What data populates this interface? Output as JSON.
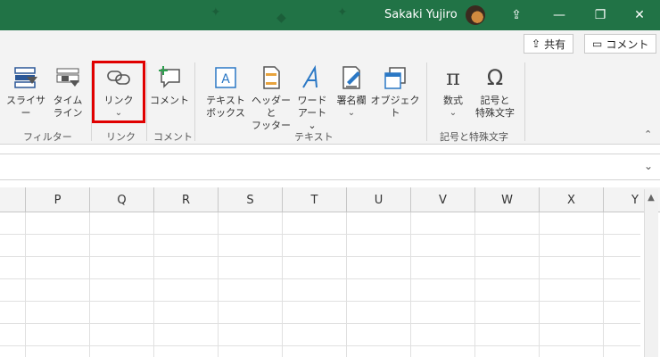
{
  "titlebar": {
    "user_name": "Sakaki Yujiro",
    "accent_color": "#217346"
  },
  "ribbon": {
    "share_label": "共有",
    "comment_label": "コメント",
    "tools": {
      "slicer": "スライサー",
      "timeline_1": "タイム",
      "timeline_2": "ライン",
      "link": "リンク",
      "comment": "コメント",
      "textbox_1": "テキスト",
      "textbox_2": "ボックス",
      "headerfooter_1": "ヘッダーと",
      "headerfooter_2": "フッター",
      "wordart_1": "ワード",
      "wordart_2": "アート",
      "signature": "署名欄",
      "object": "オブジェクト",
      "equation": "数式",
      "symbol_1": "記号と",
      "symbol_2": "特殊文字"
    },
    "groups": {
      "filter": "フィルター",
      "link": "リンク",
      "comment": "コメント",
      "text": "テキスト",
      "symbols": "記号と特殊文字"
    }
  },
  "grid": {
    "columns": [
      "P",
      "Q",
      "R",
      "S",
      "T",
      "U",
      "V",
      "W",
      "X",
      "Y"
    ]
  }
}
